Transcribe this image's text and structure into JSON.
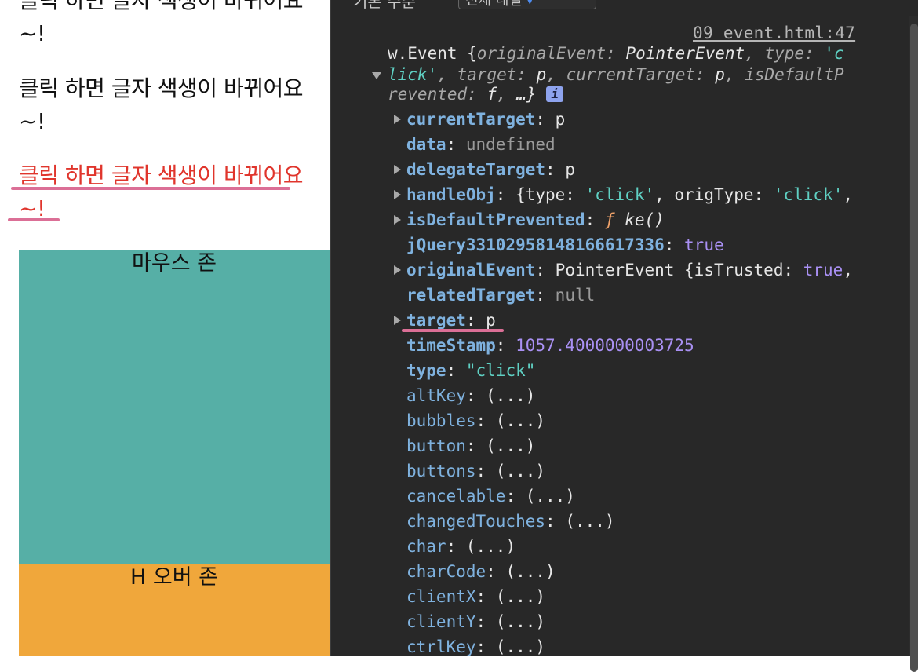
{
  "page": {
    "paragraph_1": "클릭 하면 글자 색생이 바뀌어요~!",
    "paragraph_2": "클릭 하면 글자 색생이 바뀌어요~!",
    "paragraph_3": "클릭 하면 글자 색생이 바뀌어요~!",
    "mouse_zone_label": "마우스 존",
    "hover_zone_label": "H 오버 존"
  },
  "devtools": {
    "toolbar": {
      "panel_text": "기본 수준",
      "filter_text": "전체 레벨 ",
      "filter_accent": "▾"
    },
    "source_link": "09_event.html:47",
    "summary": {
      "line1_a": "w.Event {",
      "line1_k1": "originalEvent",
      "line1_v1": "PointerEvent",
      "line1_k2": "type",
      "line1_v2": "'c",
      "line2_v2b": "lick'",
      "line2_k3": "target",
      "line2_v3": "p",
      "line2_k4": "currentTarget",
      "line2_v4": "p",
      "line2_k5": "isDefaultP",
      "line3_k5b": "revented",
      "line3_v5": "f",
      "line3_end": "…}",
      "info_badge": "i"
    },
    "properties": [
      {
        "key": "currentTarget",
        "value": "p",
        "expandable": true,
        "bold": true,
        "kind": "plain"
      },
      {
        "key": "data",
        "value": "undefined",
        "expandable": false,
        "bold": true,
        "kind": "gray"
      },
      {
        "key": "delegateTarget",
        "value": "p",
        "expandable": true,
        "bold": true,
        "kind": "plain"
      },
      {
        "key": "handleObj",
        "value": "{type: 'click', origType: 'click',",
        "expandable": true,
        "bold": true,
        "kind": "obj"
      },
      {
        "key": "isDefaultPrevented",
        "value": "ke()",
        "expandable": true,
        "bold": true,
        "kind": "fn"
      },
      {
        "key": "jQuery33102958148166617336",
        "value": "true",
        "expandable": false,
        "bold": true,
        "kind": "num"
      },
      {
        "key": "originalEvent",
        "value": "PointerEvent {isTrusted: true,",
        "expandable": true,
        "bold": true,
        "kind": "pe"
      },
      {
        "key": "relatedTarget",
        "value": "null",
        "expandable": false,
        "bold": true,
        "kind": "gray"
      },
      {
        "key": "target",
        "value": "p",
        "expandable": true,
        "bold": true,
        "kind": "plain"
      },
      {
        "key": "timeStamp",
        "value": "1057.4000000003725",
        "expandable": false,
        "bold": true,
        "kind": "num"
      },
      {
        "key": "type",
        "value": "\"click\"",
        "expandable": false,
        "bold": true,
        "kind": "str"
      },
      {
        "key": "altKey",
        "value": "(...)",
        "expandable": false,
        "bold": false,
        "kind": "lazy"
      },
      {
        "key": "bubbles",
        "value": "(...)",
        "expandable": false,
        "bold": false,
        "kind": "lazy"
      },
      {
        "key": "button",
        "value": "(...)",
        "expandable": false,
        "bold": false,
        "kind": "lazy"
      },
      {
        "key": "buttons",
        "value": "(...)",
        "expandable": false,
        "bold": false,
        "kind": "lazy"
      },
      {
        "key": "cancelable",
        "value": "(...)",
        "expandable": false,
        "bold": false,
        "kind": "lazy"
      },
      {
        "key": "changedTouches",
        "value": "(...)",
        "expandable": false,
        "bold": false,
        "kind": "lazy"
      },
      {
        "key": "char",
        "value": "(...)",
        "expandable": false,
        "bold": false,
        "kind": "lazy"
      },
      {
        "key": "charCode",
        "value": "(...)",
        "expandable": false,
        "bold": false,
        "kind": "lazy"
      },
      {
        "key": "clientX",
        "value": "(...)",
        "expandable": false,
        "bold": false,
        "kind": "lazy"
      },
      {
        "key": "clientY",
        "value": "(...)",
        "expandable": false,
        "bold": false,
        "kind": "lazy"
      },
      {
        "key": "ctrlKey",
        "value": "(...)",
        "expandable": false,
        "bold": false,
        "kind": "lazy"
      }
    ],
    "function_prefix": "ƒ"
  },
  "colors": {
    "mouse_zone": "#56afa6",
    "hover_zone": "#f0a73b",
    "clicked_text": "#e0352c",
    "highlight_underline": "#db6f96"
  }
}
